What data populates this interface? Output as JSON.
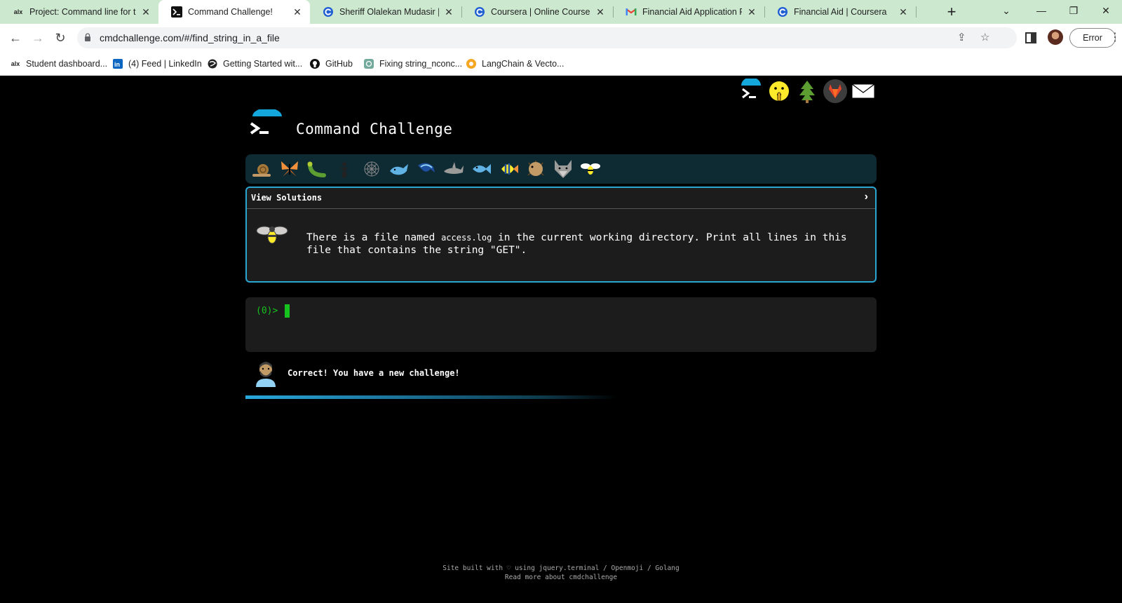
{
  "browser": {
    "tabs": [
      {
        "title": "Project: Command line for th",
        "favicon": "alx-icon"
      },
      {
        "title": "Command Challenge!",
        "favicon": "terminal-icon"
      },
      {
        "title": "Sheriff Olalekan Mudasir | Co",
        "favicon": "coursera-icon"
      },
      {
        "title": "Coursera | Online Courses Fr",
        "favicon": "coursera-icon"
      },
      {
        "title": "Financial Aid Application Rec",
        "favicon": "gmail-icon"
      },
      {
        "title": "Financial Aid | Coursera",
        "favicon": "coursera-icon"
      }
    ],
    "active_tab": 1,
    "url": "cmdchallenge.com/#/find_string_in_a_file",
    "profile_button": "Error",
    "bookmarks": [
      {
        "label": "Student dashboard...",
        "icon": "alx-icon"
      },
      {
        "label": "(4) Feed | LinkedIn",
        "icon": "linkedin-icon"
      },
      {
        "label": "Getting Started wit...",
        "icon": "globe-icon"
      },
      {
        "label": "GitHub",
        "icon": "github-icon"
      },
      {
        "label": "Fixing string_nconc...",
        "icon": "openai-icon"
      },
      {
        "label": "LangChain & Vecto...",
        "icon": "langchain-icon"
      }
    ]
  },
  "site": {
    "title": "Command Challenge",
    "top_icons": [
      "terminal-logo-icon",
      "shushing-face-icon",
      "tree-icon",
      "gitlab-icon",
      "envelope-icon"
    ],
    "emoji_strip": [
      "snail-icon",
      "butterfly-icon",
      "caterpillar-icon",
      "ant-icon",
      "spider-web-icon",
      "whale-icon",
      "dolphin-icon",
      "shark-icon",
      "fish-icon",
      "tropical-fish-icon",
      "blowfish-icon",
      "wolf-icon",
      "bee-icon"
    ],
    "challenge": {
      "header": "View Solutions",
      "text_before": "There is a file named ",
      "code": "access.log",
      "text_after": " in the current working directory. Print all lines in this file that contains the string \"GET\"."
    },
    "terminal": {
      "prompt": "(0)>"
    },
    "feedback": {
      "message": "Correct! You have a new challenge!"
    },
    "progress": 0.6,
    "footer": {
      "line1": "Site built with ♡ using jquery.terminal / Openmoji / Golang",
      "line2": "Read more about cmdchallenge"
    }
  }
}
